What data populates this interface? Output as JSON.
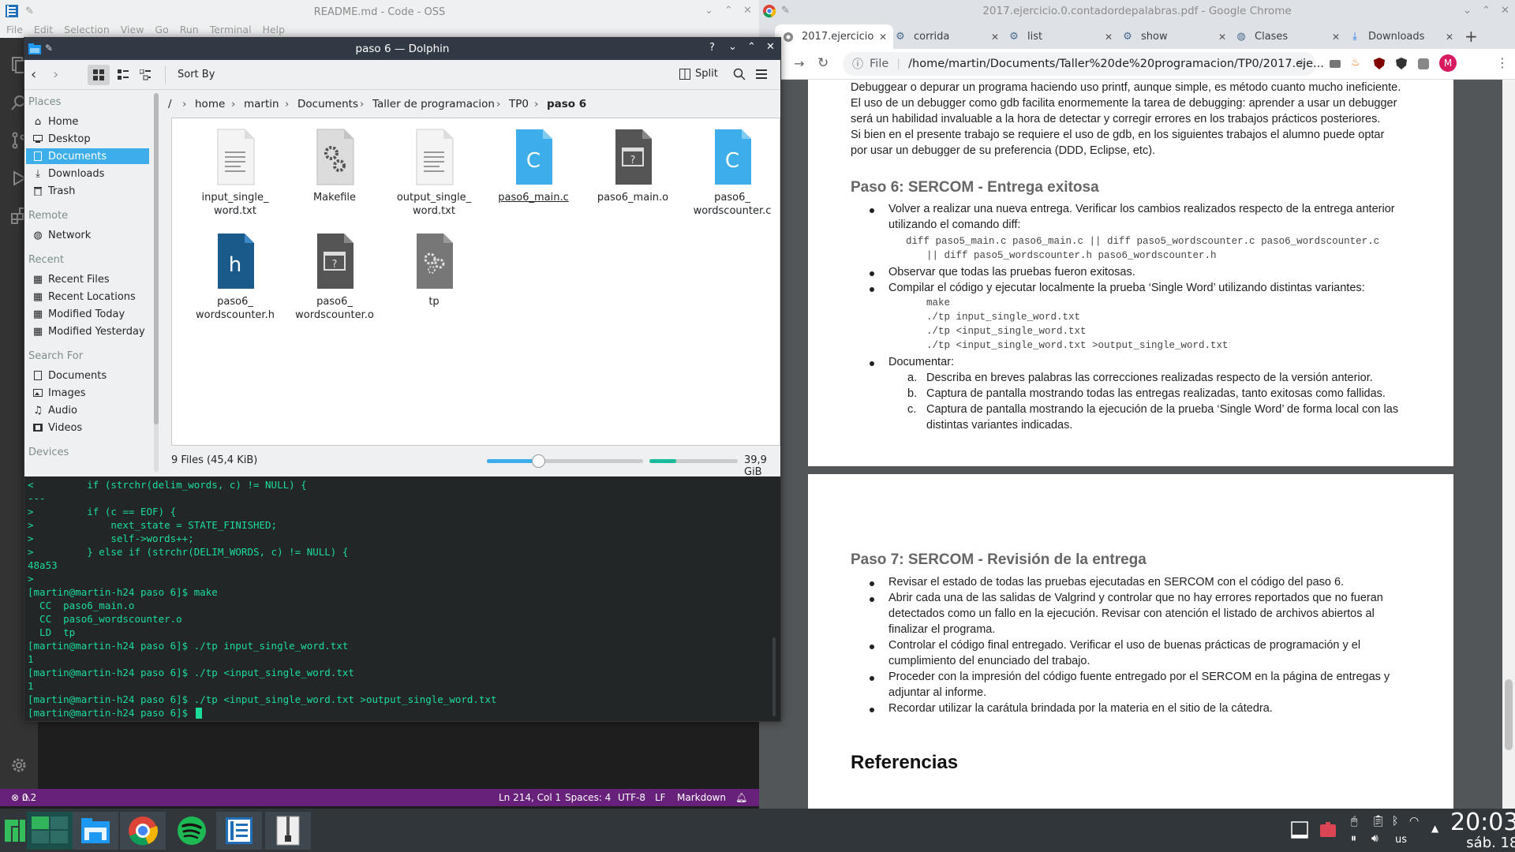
{
  "vscode": {
    "title": "README.md - Code - OSS",
    "menu": [
      "File",
      "Edit",
      "Selection",
      "View",
      "Go",
      "Run",
      "Terminal",
      "Help"
    ],
    "status": {
      "problems": "0",
      "warnings": "2",
      "position": "Ln 214, Col 1",
      "spaces": "Spaces: 4",
      "encoding": "UTF-8",
      "eol": "LF",
      "language": "Markdown"
    }
  },
  "chrome": {
    "window_title": "2017.ejercicio.0.contadordepalabras.pdf - Google Chrome",
    "tabs": [
      {
        "label": "2017.ejercicio",
        "icon": "chrome-icon",
        "active": true
      },
      {
        "label": "corrida",
        "icon": "gear-icon"
      },
      {
        "label": "list",
        "icon": "gear-icon"
      },
      {
        "label": "show",
        "icon": "gear-icon"
      },
      {
        "label": "Clases",
        "icon": "globe-icon"
      },
      {
        "label": "Downloads",
        "icon": "download-icon"
      }
    ],
    "file_label": "File",
    "url": "/home/martin/Documents/Taller%20de%20programacion/TP0/2017.eje...",
    "profile_initial": "M"
  },
  "pdf": {
    "p1_lines": [
      "Debuggear o depurar un programa haciendo uso printf, aunque simple, es método cuanto mucho ineficiente.",
      "El uso de un debugger como gdb facilita enormemente la tarea de debugging: aprender a usar un debugger",
      "será un habilidad invaluable a la hora de detectar y corregir errores en los trabajos prácticos posteriores.",
      "Si bien en el presente trabajo se requiere el uso de gdb, en los siguientes trabajos el alumno puede optar",
      "por usar un debugger de su preferencia (DDD, Eclipse, etc)."
    ],
    "paso6_heading": "Paso 6: SERCOM - Entrega exitosa",
    "paso6_b1a": "Volver a realizar una nueva entrega. Verificar los cambios realizados respecto de la entrega anterior",
    "paso6_b1b": "utilizando el comando diff:",
    "paso6_code1": "diff paso5_main.c paso6_main.c || diff paso5_wordscounter.c paso6_wordscounter.c",
    "paso6_code2": "|| diff paso5_wordscounter.h paso6_wordscounter.h",
    "paso6_b2": "Observar que todas las pruebas fueron exitosas.",
    "paso6_b3": "Compilar el código y ejecutar localmente la prueba ‘Single Word’ utilizando distintas variantes:",
    "paso6_cmds": [
      "make",
      "./tp input_single_word.txt",
      "./tp <input_single_word.txt",
      "./tp <input_single_word.txt >output_single_word.txt"
    ],
    "paso6_b4": "Documentar:",
    "paso6_a": "Describa en breves palabras las correcciones realizadas respecto de la versión anterior.",
    "paso6_b": "Captura de pantalla mostrando todas las entregas realizadas, tanto exitosas como fallidas.",
    "paso6_c1": "Captura de pantalla mostrando la ejecución de la prueba ‘Single Word’ de forma local con las",
    "paso6_c2": "distintas variantes indicadas.",
    "markers": [
      "a.",
      "b.",
      "c."
    ],
    "paso7_heading": "Paso 7: SERCOM - Revisión de la entrega",
    "paso7_b1": "Revisar el estado de todas las pruebas ejecutadas en SERCOM con el código del paso 6.",
    "paso7_b2a": "Abrir cada una de las salidas de Valgrind y controlar que no hay errores reportados que no fueran",
    "paso7_b2b": "detectados como un fallo en la ejecución. Revisar con atención el listado de archivos abiertos al",
    "paso7_b2c": "finalizar el programa.",
    "paso7_b3a": "Controlar el código final  entregado. Verificar el uso de buenas prácticas de programación y el",
    "paso7_b3b": "cumplimiento del enunciado del trabajo.",
    "paso7_b4a": "Proceder con la impresión del código fuente entregado por el SERCOM en la página de entregas y",
    "paso7_b4b": "adjuntar al informe.",
    "paso7_b5": "Recordar utilizar la carátula brindada por la materia en el sitio de la cátedra.",
    "ref_heading": "Referencias"
  },
  "dolphin": {
    "title": "paso 6 — Dolphin",
    "sort_by": "Sort By",
    "split": "Split",
    "places": {
      "places_header": "Places",
      "places_items": [
        "Home",
        "Desktop",
        "Documents",
        "Downloads",
        "Trash"
      ],
      "remote_header": "Remote",
      "remote_items": [
        "Network"
      ],
      "recent_header": "Recent",
      "recent_items": [
        "Recent Files",
        "Recent Locations",
        "Modified Today",
        "Modified Yesterday"
      ],
      "search_header": "Search For",
      "search_items": [
        "Documents",
        "Images",
        "Audio",
        "Videos"
      ],
      "devices_header": "Devices"
    },
    "breadcrumb": [
      "/",
      "home",
      "martin",
      "Documents",
      "Taller de programacion",
      "TP0",
      "paso 6"
    ],
    "files": [
      {
        "l1": "input_single_",
        "l2": "word.txt",
        "type": "text"
      },
      {
        "l1": "Makefile",
        "l2": "",
        "type": "makefile"
      },
      {
        "l1": "output_single_",
        "l2": "word.txt",
        "type": "text"
      },
      {
        "l1": "paso6_main.c",
        "l2": "",
        "type": "c"
      },
      {
        "l1": "paso6_main.o",
        "l2": "",
        "type": "object"
      },
      {
        "l1": "paso6_",
        "l2": "wordscounter.c",
        "type": "c"
      },
      {
        "l1": "paso6_",
        "l2": "wordscounter.h",
        "type": "h"
      },
      {
        "l1": "paso6_",
        "l2": "wordscounter.o",
        "type": "object"
      },
      {
        "l1": "tp",
        "l2": "",
        "type": "exec"
      }
    ],
    "status_files": "9 Files (45,4 KiB)",
    "zoom_level": 0.33,
    "disk_used": 0.3,
    "free_space": "39,9 GiB free"
  },
  "terminal": {
    "lines": [
      "<         if (strchr(delim_words, c) != NULL) {",
      "---",
      ">         if (c == EOF) {",
      ">             next_state = STATE_FINISHED;",
      ">             self->words++;",
      ">         } else if (strchr(DELIM_WORDS, c) != NULL) {",
      "48a53",
      ">",
      "[martin@martin-h24 paso 6]$ make",
      "  CC  paso6_main.o",
      "  CC  paso6_wordscounter.o",
      "  LD  tp",
      "[martin@martin-h24 paso 6]$ ./tp input_single_word.txt",
      "1",
      "[martin@martin-h24 paso 6]$ ./tp <input_single_word.txt",
      "1",
      "[martin@martin-h24 paso 6]$ ./tp <input_single_word.txt >output_single_word.txt",
      "[martin@martin-h24 paso 6]$ "
    ]
  },
  "taskbar": {
    "time": "20:03",
    "date": "sáb. 18",
    "keyboard": "us"
  },
  "colors": {
    "accent": "#3daee9",
    "vscode_status": "#68217a",
    "terminal_fg": "#1cdc9a",
    "terminal_bg": "#232627"
  }
}
